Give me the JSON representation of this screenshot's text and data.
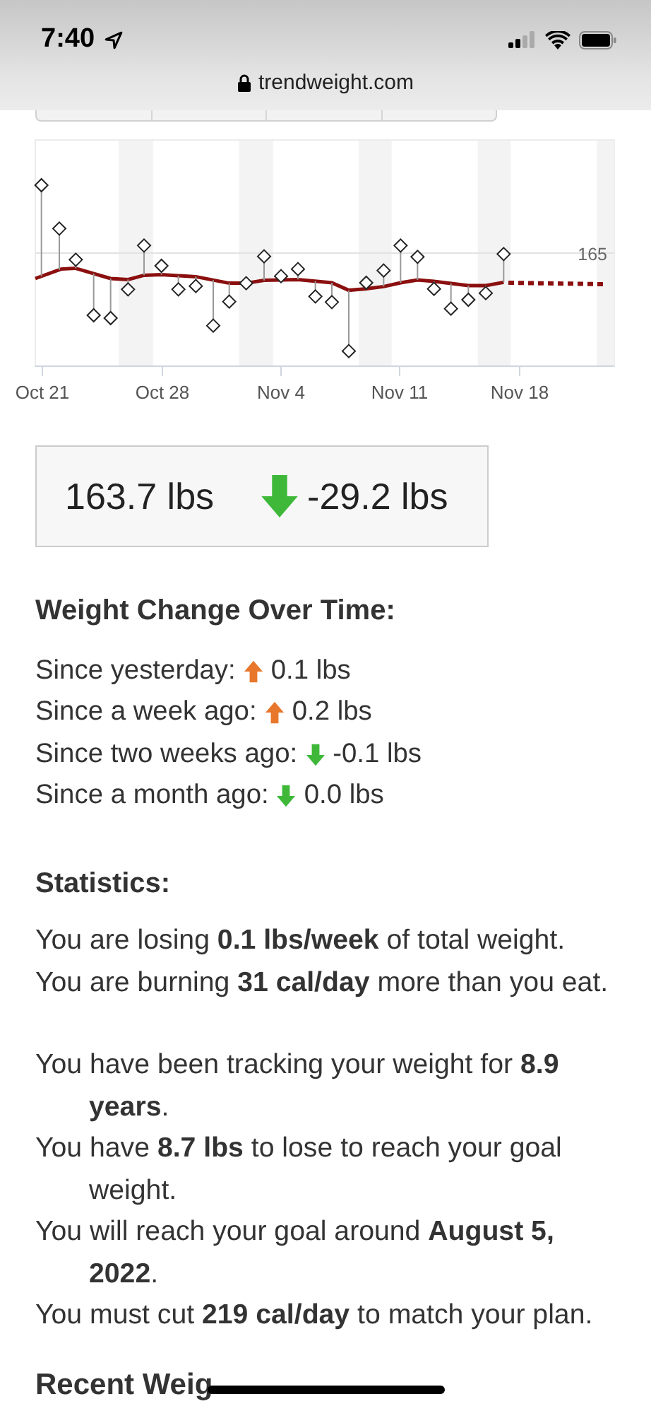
{
  "status_bar": {
    "time": "7:40"
  },
  "browser": {
    "url": "trendweight.com"
  },
  "chart": {
    "y_tick": "165",
    "x_labels": [
      "Oct 21",
      "Oct 28",
      "Nov 4",
      "Nov 11",
      "Nov 18"
    ]
  },
  "summary": {
    "current": "163.7 lbs",
    "change": "-29.2 lbs",
    "kind": "down"
  },
  "weight_change": {
    "title": "Weight Change Over Time:",
    "rows": [
      {
        "label": "Since yesterday:",
        "kind": "up",
        "value": "0.1 lbs"
      },
      {
        "label": "Since a week ago:",
        "kind": "up",
        "value": "0.2 lbs"
      },
      {
        "label": "Since two weeks ago:",
        "kind": "down",
        "value": "-0.1 lbs"
      },
      {
        "label": "Since a month ago:",
        "kind": "down",
        "value": "0.0 lbs"
      }
    ]
  },
  "statistics": {
    "title": "Statistics:",
    "groups": [
      [
        "You are losing **0.1 lbs/week** of total weight.",
        "You are burning **31 cal/day** more than you eat."
      ],
      [
        "You have been tracking your weight for **8.9 years**.",
        "You have **8.7 lbs** to lose to reach your goal weight.",
        "You will reach your goal around **August 5, 2022**.",
        "You must cut **219 cal/day** to match your plan."
      ]
    ]
  },
  "next_heading": "Recent Weig"
}
